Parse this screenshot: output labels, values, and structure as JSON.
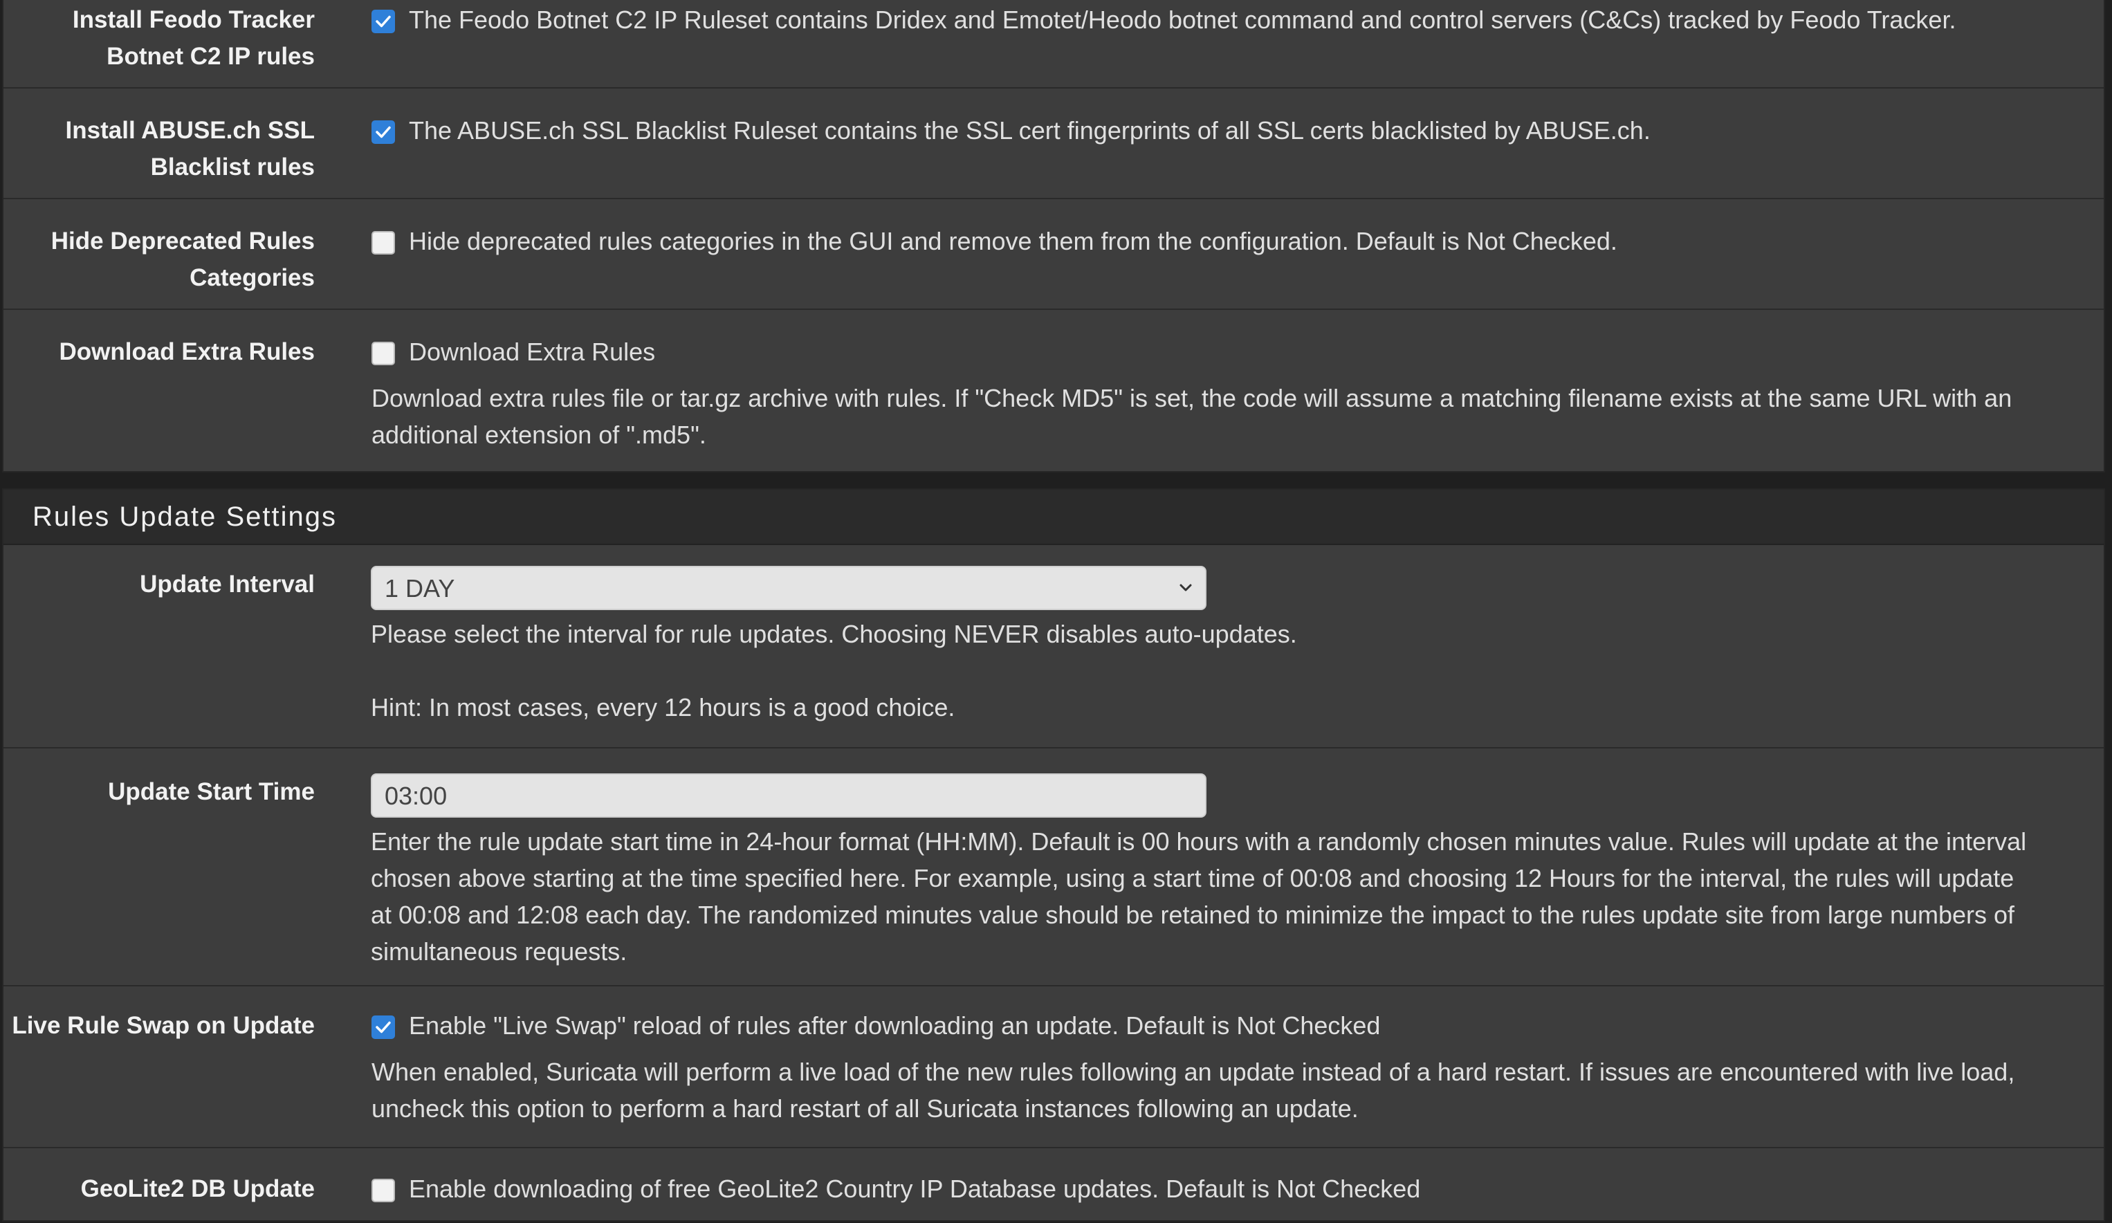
{
  "top_panel": {
    "rows": [
      {
        "label_line1": "Install Feodo Tracker",
        "label_line2": "Botnet C2 IP rules",
        "checked": true,
        "text": "The Feodo Botnet C2 IP Ruleset contains Dridex and Emotet/Heodo botnet command and control servers (C&Cs) tracked by Feodo Tracker."
      },
      {
        "label_line1": "Install ABUSE.ch SSL",
        "label_line2": "Blacklist rules",
        "checked": true,
        "text": "The ABUSE.ch SSL Blacklist Ruleset contains the SSL cert fingerprints of all SSL certs blacklisted by ABUSE.ch."
      },
      {
        "label_line1": "Hide Deprecated Rules",
        "label_line2": "Categories",
        "checked": false,
        "text": "Hide deprecated rules categories in the GUI and remove them from the configuration. Default is Not Checked."
      },
      {
        "label_line1": "Download Extra Rules",
        "checked": false,
        "text": "Download Extra Rules",
        "help_line1": "Download extra rules file or tar.gz archive with rules. If \"Check MD5\" is set, the code will assume a matching filename exists at the same URL with an",
        "help_line2": "additional extension of \".md5\"."
      }
    ]
  },
  "rules_update": {
    "title": "Rules Update Settings",
    "update_interval": {
      "label": "Update Interval",
      "value": "1 DAY",
      "help_line1": "Please select the interval for rule updates. Choosing NEVER disables auto-updates.",
      "help_line2": "Hint: In most cases, every 12 hours is a good choice."
    },
    "update_start_time": {
      "label": "Update Start Time",
      "value": "03:00",
      "help_line1": "Enter the rule update start time in 24-hour format (HH:MM). Default is 00 hours with a randomly chosen minutes value. Rules will update at the interval",
      "help_line2": "chosen above starting at the time specified here. For example, using a start time of 00:08 and choosing 12 Hours for the interval, the rules will update",
      "help_line3": "at 00:08 and 12:08 each day. The randomized minutes value should be retained to minimize the impact to the rules update site from large numbers of",
      "help_line4": "simultaneous requests."
    },
    "live_swap": {
      "label": "Live Rule Swap on Update",
      "checked": true,
      "text": "Enable \"Live Swap\" reload of rules after downloading an update. Default is Not Checked",
      "help_line1": "When enabled, Suricata will perform a live load of the new rules following an update instead of a hard restart. If issues are encountered with live load,",
      "help_line2": "uncheck this option to perform a hard restart of all Suricata instances following an update."
    },
    "geolite": {
      "label": "GeoLite2 DB Update",
      "checked": false,
      "text": "Enable downloading of free GeoLite2 Country IP Database updates. Default is Not Checked"
    }
  },
  "colors": {
    "panel_bg": "#3d3d3d",
    "header_bg": "#2b2b2b",
    "checkbox_checked": "#2f80d9",
    "field_bg": "#e4e4e4"
  }
}
